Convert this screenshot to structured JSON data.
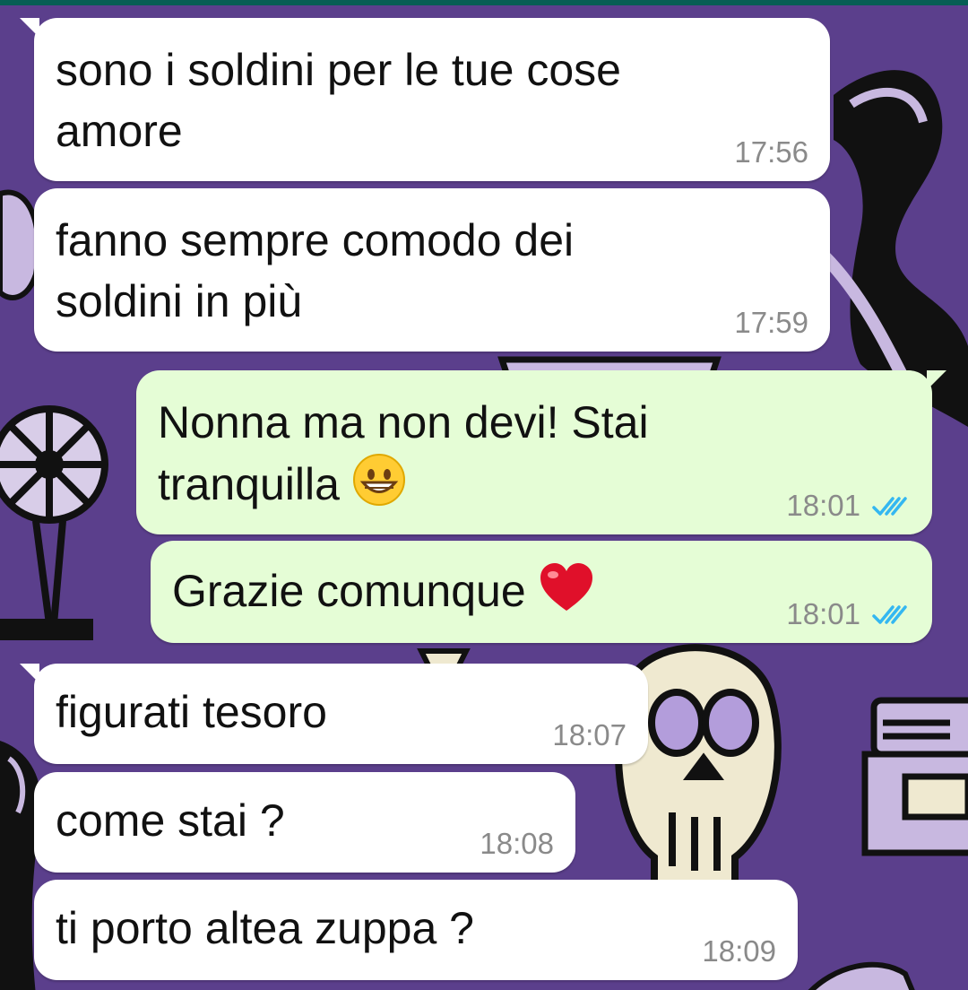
{
  "colors": {
    "wallpaper": "#5b3f8c",
    "incoming_bubble": "#ffffff",
    "outgoing_bubble": "#e5fdd6",
    "timestamp": "#8a8a8a",
    "read_ticks": "#34b7f1"
  },
  "messages": [
    {
      "direction": "in",
      "text": "sono i soldini per le tue cose\namore",
      "time": "17:56"
    },
    {
      "direction": "in",
      "text": "fanno sempre comodo dei\nsoldini in più",
      "time": "17:59"
    },
    {
      "direction": "out",
      "text": "Nonna ma non devi! Stai\ntranquilla",
      "emoji": "grinning-face-emoji",
      "time": "18:01",
      "status_icon": "double-check-read-icon"
    },
    {
      "direction": "out",
      "text": "Grazie comunque",
      "emoji": "red-heart-emoji",
      "time": "18:01",
      "status_icon": "double-check-read-icon"
    },
    {
      "direction": "in",
      "text": "figurati tesoro",
      "time": "18:07"
    },
    {
      "direction": "in",
      "text": "come stai ?",
      "time": "18:08"
    },
    {
      "direction": "in",
      "text": "ti porto altea zuppa ?",
      "time": "18:09"
    }
  ]
}
